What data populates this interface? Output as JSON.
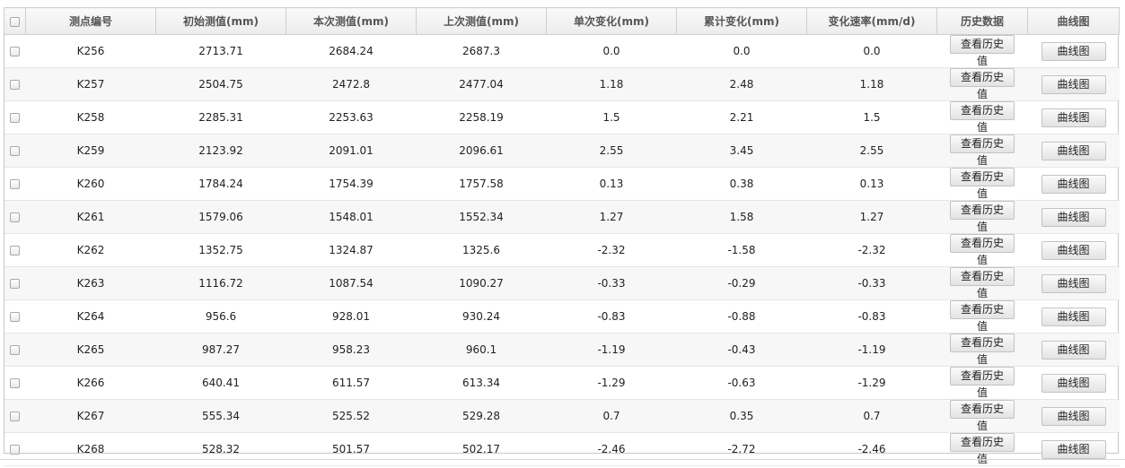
{
  "header": {
    "point_id": "测点编号",
    "initial": "初始测值(mm)",
    "current": "本次测值(mm)",
    "previous": "上次测值(mm)",
    "single_change": "单次变化(mm)",
    "cumulative_change": "累计变化(mm)",
    "change_rate": "变化速率(mm/d)",
    "history": "历史数据",
    "curve": "曲线图"
  },
  "buttons": {
    "history": "查看历史值",
    "curve": "曲线图"
  },
  "rows": [
    {
      "id": "K256",
      "initial": "2713.71",
      "current": "2684.24",
      "previous": "2687.3",
      "single": "0.0",
      "cumulative": "0.0",
      "rate": "0.0"
    },
    {
      "id": "K257",
      "initial": "2504.75",
      "current": "2472.8",
      "previous": "2477.04",
      "single": "1.18",
      "cumulative": "2.48",
      "rate": "1.18"
    },
    {
      "id": "K258",
      "initial": "2285.31",
      "current": "2253.63",
      "previous": "2258.19",
      "single": "1.5",
      "cumulative": "2.21",
      "rate": "1.5"
    },
    {
      "id": "K259",
      "initial": "2123.92",
      "current": "2091.01",
      "previous": "2096.61",
      "single": "2.55",
      "cumulative": "3.45",
      "rate": "2.55"
    },
    {
      "id": "K260",
      "initial": "1784.24",
      "current": "1754.39",
      "previous": "1757.58",
      "single": "0.13",
      "cumulative": "0.38",
      "rate": "0.13"
    },
    {
      "id": "K261",
      "initial": "1579.06",
      "current": "1548.01",
      "previous": "1552.34",
      "single": "1.27",
      "cumulative": "1.58",
      "rate": "1.27"
    },
    {
      "id": "K262",
      "initial": "1352.75",
      "current": "1324.87",
      "previous": "1325.6",
      "single": "-2.32",
      "cumulative": "-1.58",
      "rate": "-2.32"
    },
    {
      "id": "K263",
      "initial": "1116.72",
      "current": "1087.54",
      "previous": "1090.27",
      "single": "-0.33",
      "cumulative": "-0.29",
      "rate": "-0.33"
    },
    {
      "id": "K264",
      "initial": "956.6",
      "current": "928.01",
      "previous": "930.24",
      "single": "-0.83",
      "cumulative": "-0.88",
      "rate": "-0.83"
    },
    {
      "id": "K265",
      "initial": "987.27",
      "current": "958.23",
      "previous": "960.1",
      "single": "-1.19",
      "cumulative": "-0.43",
      "rate": "-1.19"
    },
    {
      "id": "K266",
      "initial": "640.41",
      "current": "611.57",
      "previous": "613.34",
      "single": "-1.29",
      "cumulative": "-0.63",
      "rate": "-1.29"
    },
    {
      "id": "K267",
      "initial": "555.34",
      "current": "525.52",
      "previous": "529.28",
      "single": "0.7",
      "cumulative": "0.35",
      "rate": "0.7"
    },
    {
      "id": "K268",
      "initial": "528.32",
      "current": "501.57",
      "previous": "502.17",
      "single": "-2.46",
      "cumulative": "-2.72",
      "rate": "-2.46"
    }
  ]
}
